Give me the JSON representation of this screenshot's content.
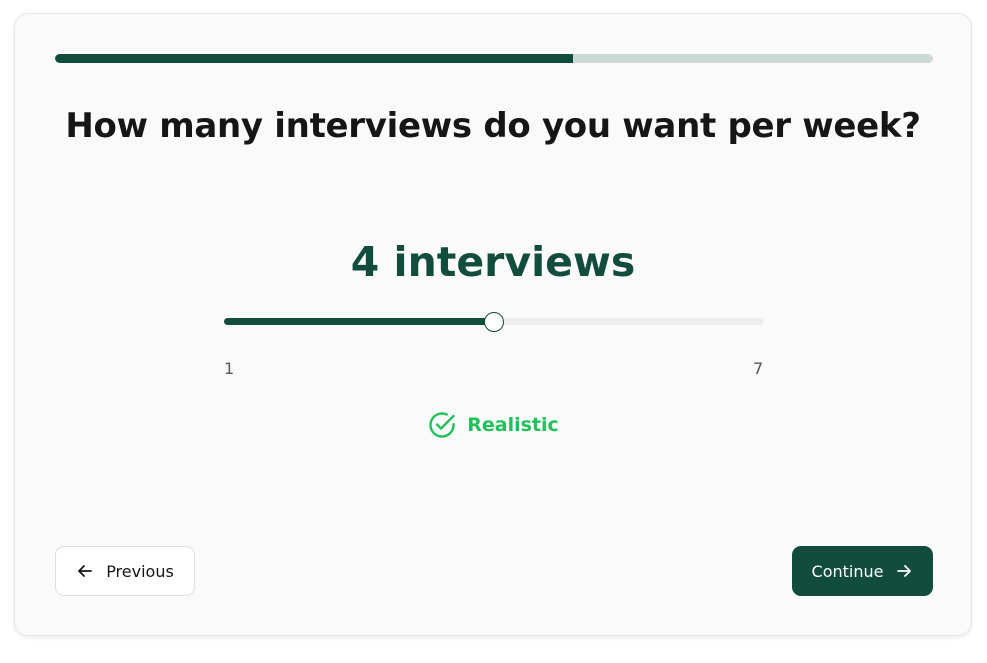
{
  "progress": {
    "fraction": 0.59,
    "fill_color": "#114c3c",
    "track_color": "#cdd9d5"
  },
  "question": {
    "title": "How many interviews do you want per week?"
  },
  "slider": {
    "value_text": "4 interviews",
    "value": 4,
    "min": 1,
    "max": 7,
    "min_label": "1",
    "max_label": "7",
    "accent_color": "#114c3c"
  },
  "status": {
    "icon": "check-circle-icon",
    "label": "Realistic",
    "color": "#1fc15a"
  },
  "nav": {
    "previous_label": "Previous",
    "previous_icon": "arrow-left-icon",
    "continue_label": "Continue",
    "continue_icon": "arrow-right-icon"
  }
}
